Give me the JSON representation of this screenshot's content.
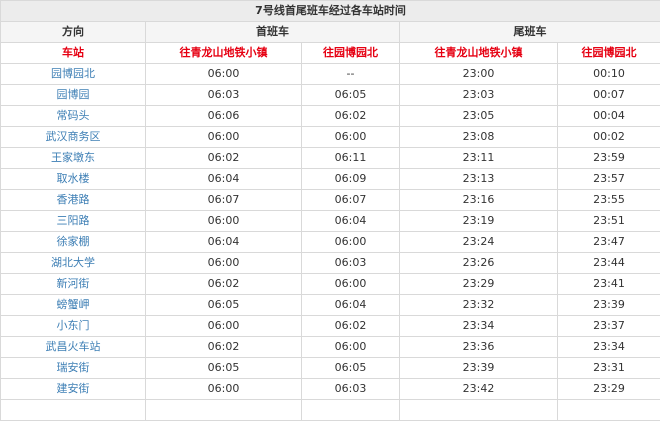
{
  "table": {
    "title": "7号线首尾班车经过各车站时间",
    "col_direction": "方向",
    "col_first": "首班车",
    "col_last": "尾班车",
    "col_station": "车站",
    "dir_1": "往青龙山地铁小镇",
    "dir_2": "往园博园北",
    "dir_3": "往青龙山地铁小镇",
    "dir_4": "往园博园北",
    "rows": [
      {
        "station": "园博园北",
        "first_1": "06:00",
        "first_2": "--",
        "last_1": "23:00",
        "last_2": "00:10"
      },
      {
        "station": "园博园",
        "first_1": "06:03",
        "first_2": "06:05",
        "last_1": "23:03",
        "last_2": "00:07"
      },
      {
        "station": "常码头",
        "first_1": "06:06",
        "first_2": "06:02",
        "last_1": "23:05",
        "last_2": "00:04"
      },
      {
        "station": "武汉商务区",
        "first_1": "06:00",
        "first_2": "06:00",
        "last_1": "23:08",
        "last_2": "00:02"
      },
      {
        "station": "王家墩东",
        "first_1": "06:02",
        "first_2": "06:11",
        "last_1": "23:11",
        "last_2": "23:59"
      },
      {
        "station": "取水楼",
        "first_1": "06:04",
        "first_2": "06:09",
        "last_1": "23:13",
        "last_2": "23:57"
      },
      {
        "station": "香港路",
        "first_1": "06:07",
        "first_2": "06:07",
        "last_1": "23:16",
        "last_2": "23:55"
      },
      {
        "station": "三阳路",
        "first_1": "06:00",
        "first_2": "06:04",
        "last_1": "23:19",
        "last_2": "23:51"
      },
      {
        "station": "徐家棚",
        "first_1": "06:04",
        "first_2": "06:00",
        "last_1": "23:24",
        "last_2": "23:47"
      },
      {
        "station": "湖北大学",
        "first_1": "06:00",
        "first_2": "06:03",
        "last_1": "23:26",
        "last_2": "23:44"
      },
      {
        "station": "新河街",
        "first_1": "06:02",
        "first_2": "06:00",
        "last_1": "23:29",
        "last_2": "23:41"
      },
      {
        "station": "螃蟹岬",
        "first_1": "06:05",
        "first_2": "06:04",
        "last_1": "23:32",
        "last_2": "23:39"
      },
      {
        "station": "小东门",
        "first_1": "06:00",
        "first_2": "06:02",
        "last_1": "23:34",
        "last_2": "23:37"
      },
      {
        "station": "武昌火车站",
        "first_1": "06:02",
        "first_2": "06:00",
        "last_1": "23:36",
        "last_2": "23:34"
      },
      {
        "station": "瑞安街",
        "first_1": "06:05",
        "first_2": "06:05",
        "last_1": "23:39",
        "last_2": "23:31"
      },
      {
        "station": "建安街",
        "first_1": "06:00",
        "first_2": "06:03",
        "last_1": "23:42",
        "last_2": "23:29"
      },
      {
        "station": "",
        "first_1": "",
        "first_2": "",
        "last_1": "",
        "last_2": ""
      }
    ]
  }
}
